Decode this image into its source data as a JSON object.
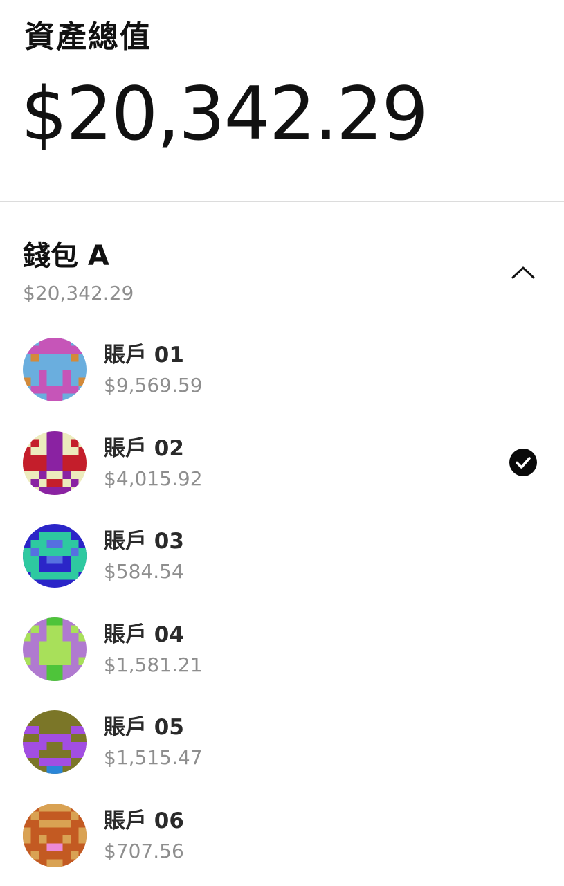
{
  "summary": {
    "label": "資產總值",
    "total": "$20,342.29"
  },
  "wallet": {
    "name": "錢包 A",
    "total": "$20,342.29",
    "expanded": true,
    "toggle_icon": "chevron-up-icon"
  },
  "accounts": [
    {
      "name": "賬戶 01",
      "balance": "$9,569.59",
      "selected": false,
      "avatar_colors": {
        "bg": "#6aaede",
        "fg": "#c655b8",
        "accent": "#d38a3a"
      }
    },
    {
      "name": "賬戶 02",
      "balance": "$4,015.92",
      "selected": true,
      "avatar_colors": {
        "bg": "#ecebbd",
        "fg": "#8a22a2",
        "accent": "#c41e2b"
      }
    },
    {
      "name": "賬戶 03",
      "balance": "$584.54",
      "selected": false,
      "avatar_colors": {
        "bg": "#2b25c8",
        "fg": "#2ec9a0",
        "accent": "#5670e0"
      }
    },
    {
      "name": "賬戶 04",
      "balance": "$1,581.21",
      "selected": false,
      "avatar_colors": {
        "bg": "#b07ad0",
        "fg": "#a8e05a",
        "accent": "#4ec43a"
      }
    },
    {
      "name": "賬戶 05",
      "balance": "$1,515.47",
      "selected": false,
      "avatar_colors": {
        "bg": "#7b7628",
        "fg": "#a24ee2",
        "accent": "#2a86d8"
      }
    },
    {
      "name": "賬戶 06",
      "balance": "$707.56",
      "selected": false,
      "avatar_colors": {
        "bg": "#c35a22",
        "fg": "#d9a253",
        "accent": "#ec8ad6"
      }
    }
  ]
}
